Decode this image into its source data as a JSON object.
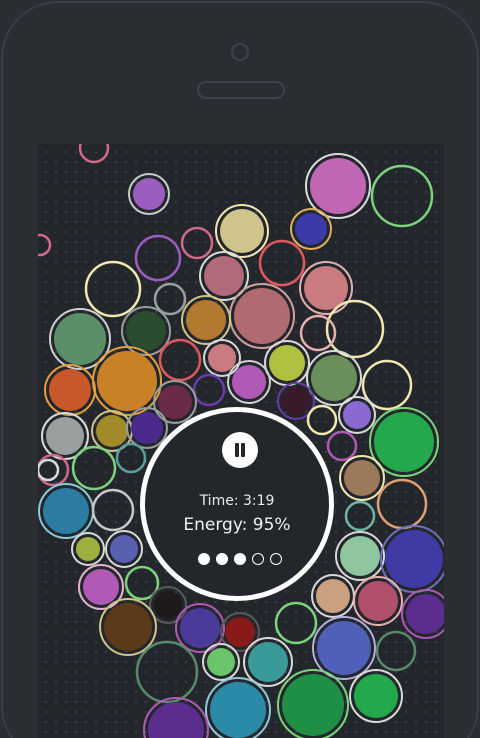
{
  "hud": {
    "time_label": "Time: 3:19",
    "energy_label": "Energy: 95%",
    "pause_icon": "pause-icon",
    "progress": {
      "filled": 3,
      "total": 5
    }
  },
  "palette": {
    "background": "#23272c",
    "frame": "#2a2d31",
    "hud_ring": "#ffffff",
    "bubble_colors": [
      "#c166b4",
      "#7bd47b",
      "#cfc48b",
      "#e0585e",
      "#4a8a5f",
      "#c98126",
      "#2b4c2f",
      "#b17a30",
      "#2b7ca0",
      "#23a94b",
      "#3f3aa4",
      "#8fc6a0",
      "#2aa8b7",
      "#1f8f45",
      "#5f55b5",
      "#5a2d8f",
      "#b0506a"
    ]
  }
}
